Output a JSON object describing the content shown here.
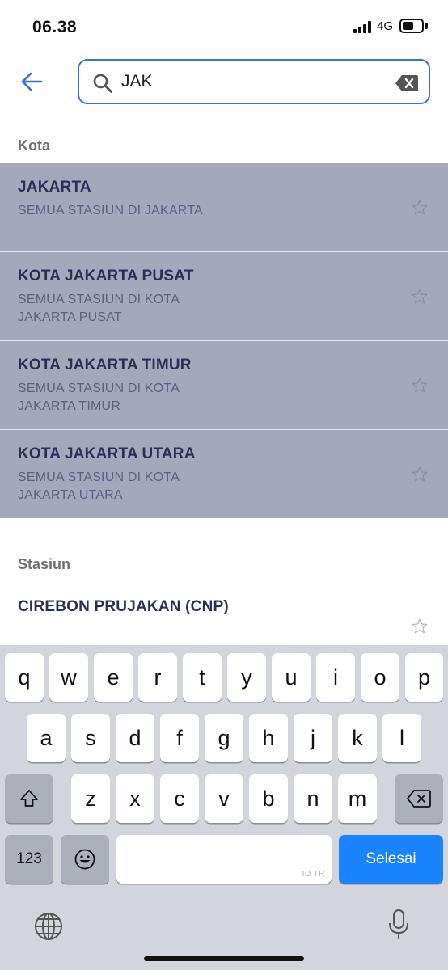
{
  "status_bar": {
    "time": "06.38",
    "network": "4G"
  },
  "search": {
    "value": "JAK",
    "back_icon": "arrow-left-icon",
    "search_icon": "magnifier-icon",
    "clear_icon": "backspace-clear-icon"
  },
  "sections": {
    "city_title": "Kota",
    "station_title": "Stasiun"
  },
  "cities": [
    {
      "name": "JAKARTA",
      "description": "SEMUA STASIUN DI JAKARTA"
    },
    {
      "name": "KOTA JAKARTA PUSAT",
      "description": "SEMUA STASIUN DI KOTA JAKARTA PUSAT"
    },
    {
      "name": "KOTA JAKARTA TIMUR",
      "description": "SEMUA STASIUN DI KOTA JAKARTA TIMUR"
    },
    {
      "name": "KOTA JAKARTA UTARA",
      "description": "SEMUA STASIUN DI KOTA JAKARTA UTARA"
    }
  ],
  "stations": [
    {
      "name": "CIREBON PRUJAKAN (CNP)"
    }
  ],
  "keyboard": {
    "row1": [
      "q",
      "w",
      "e",
      "r",
      "t",
      "y",
      "u",
      "i",
      "o",
      "p"
    ],
    "row2": [
      "a",
      "s",
      "d",
      "f",
      "g",
      "h",
      "j",
      "k",
      "l"
    ],
    "row3": [
      "z",
      "x",
      "c",
      "v",
      "b",
      "n",
      "m"
    ],
    "numbers_key": "123",
    "done_key": "Selesai",
    "space_hint": "ID TR"
  },
  "colors": {
    "accent": "#3b6fd6",
    "highlight_row": "#a5a8bb",
    "done_key": "#1a84ff"
  }
}
